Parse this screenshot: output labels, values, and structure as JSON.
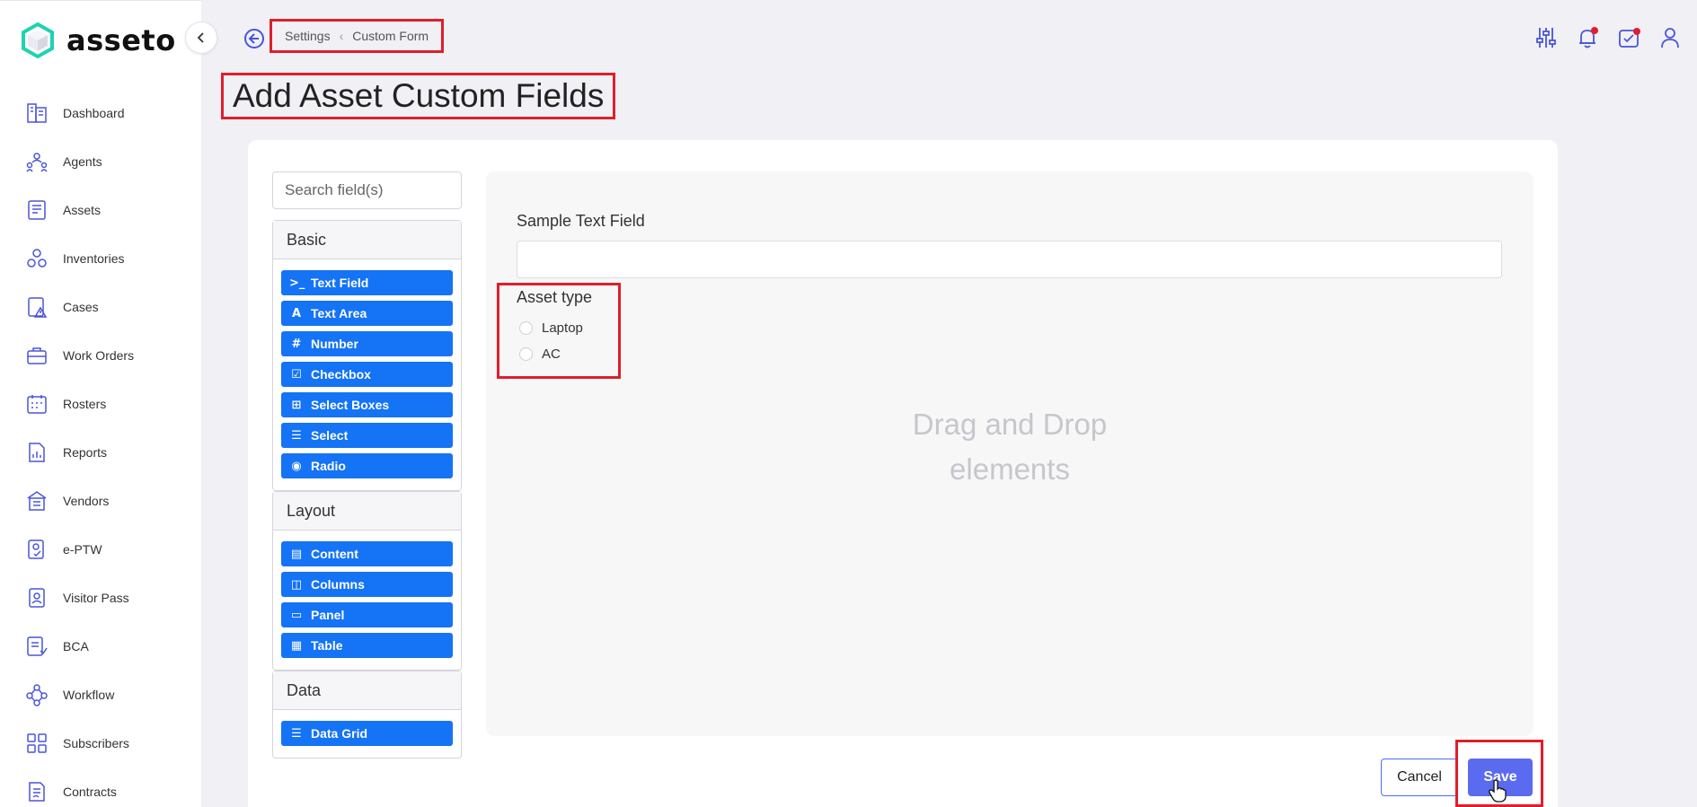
{
  "app": {
    "name": "asseto"
  },
  "colors": {
    "accent": "#5b6bf0",
    "component": "#1573f5",
    "highlight": "#e01e2b",
    "icon": "#4a55d8"
  },
  "sidebar": {
    "items": [
      {
        "label": "Dashboard",
        "icon": "dashboard-icon"
      },
      {
        "label": "Agents",
        "icon": "agents-icon"
      },
      {
        "label": "Assets",
        "icon": "assets-icon"
      },
      {
        "label": "Inventories",
        "icon": "inventories-icon"
      },
      {
        "label": "Cases",
        "icon": "cases-icon"
      },
      {
        "label": "Work Orders",
        "icon": "work-orders-icon"
      },
      {
        "label": "Rosters",
        "icon": "rosters-icon"
      },
      {
        "label": "Reports",
        "icon": "reports-icon"
      },
      {
        "label": "Vendors",
        "icon": "vendors-icon"
      },
      {
        "label": "e-PTW",
        "icon": "eptw-icon"
      },
      {
        "label": "Visitor Pass",
        "icon": "visitor-pass-icon"
      },
      {
        "label": "BCA",
        "icon": "bca-icon"
      },
      {
        "label": "Workflow",
        "icon": "workflow-icon"
      },
      {
        "label": "Subscribers",
        "icon": "subscribers-icon"
      },
      {
        "label": "Contracts",
        "icon": "contracts-icon"
      }
    ]
  },
  "breadcrumb": {
    "first": "Settings",
    "second": "Custom Form"
  },
  "page": {
    "title": "Add Asset Custom Fields"
  },
  "palette": {
    "search_placeholder": "Search field(s)",
    "groups": {
      "basic": {
        "title": "Basic",
        "components": [
          {
            "label": "Text Field",
            "glyph": ">_"
          },
          {
            "label": "Text Area",
            "glyph": "A"
          },
          {
            "label": "Number",
            "glyph": "#"
          },
          {
            "label": "Checkbox",
            "glyph": "☑"
          },
          {
            "label": "Select Boxes",
            "glyph": "⊞"
          },
          {
            "label": "Select",
            "glyph": "☰"
          },
          {
            "label": "Radio",
            "glyph": "◉"
          }
        ]
      },
      "layout": {
        "title": "Layout",
        "components": [
          {
            "label": "Content",
            "glyph": "▤"
          },
          {
            "label": "Columns",
            "glyph": "◫"
          },
          {
            "label": "Panel",
            "glyph": "▭"
          },
          {
            "label": "Table",
            "glyph": "▦"
          }
        ]
      },
      "data": {
        "title": "Data",
        "components": [
          {
            "label": "Data Grid",
            "glyph": "☰"
          }
        ]
      }
    }
  },
  "form": {
    "text_field_label": "Sample Text Field",
    "text_field_value": "",
    "radio_label": "Asset type",
    "radio_options": [
      "Laptop",
      "AC"
    ],
    "drop_hint_line1": "Drag and Drop",
    "drop_hint_line2": "elements"
  },
  "actions": {
    "cancel": "Cancel",
    "save": "Save"
  }
}
